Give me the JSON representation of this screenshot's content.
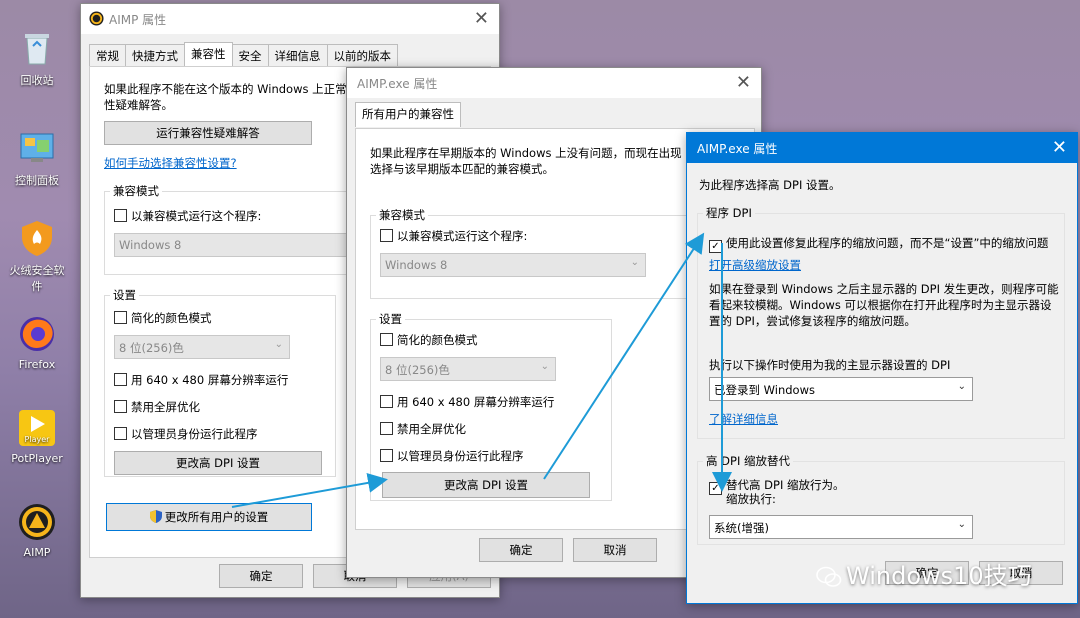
{
  "desktop": {
    "icons": [
      "回收站",
      "控制面板",
      "火绒安全软件",
      "Firefox",
      "PotPlayer",
      "AIMP"
    ],
    "potplayer_badge": "Player"
  },
  "win1": {
    "title": "AIMP 属性",
    "tabs": [
      "常规",
      "快捷方式",
      "兼容性",
      "安全",
      "详细信息",
      "以前的版本"
    ],
    "intro": "如果此程序不能在这个版本的 Windows 上正常",
    "intro2": "性疑难解答。",
    "troubleshoot_btn": "运行兼容性疑难解答",
    "manual_link": "如何手动选择兼容性设置?",
    "compat_group": "兼容模式",
    "compat_cb": "以兼容模式运行这个程序:",
    "compat_select": "Windows 8",
    "settings_group": "设置",
    "color_cb": "简化的颜色模式",
    "color_select": "8 位(256)色",
    "res_cb": "用 640 x 480 屏幕分辨率运行",
    "fullscreen_cb": "禁用全屏优化",
    "admin_cb": "以管理员身份运行此程序",
    "dpi_btn": "更改高 DPI 设置",
    "all_users_btn": "更改所有用户的设置",
    "ok": "确定",
    "cancel": "取消",
    "apply": "应用(A)"
  },
  "win2": {
    "title": "AIMP.exe 属性",
    "tab": "所有用户的兼容性",
    "intro": "如果此程序在早期版本的 Windows 上没有问题，而现在出现",
    "intro2": "选择与该早期版本匹配的兼容模式。",
    "compat_group": "兼容模式",
    "compat_cb": "以兼容模式运行这个程序:",
    "compat_select": "Windows 8",
    "settings_group": "设置",
    "color_cb": "简化的颜色模式",
    "color_select": "8 位(256)色",
    "res_cb": "用 640 x 480 屏幕分辨率运行",
    "fullscreen_cb": "禁用全屏优化",
    "admin_cb": "以管理员身份运行此程序",
    "dpi_btn": "更改高 DPI 设置",
    "ok": "确定",
    "cancel": "取消"
  },
  "win3": {
    "title": "AIMP.exe 属性",
    "heading": "为此程序选择高 DPI 设置。",
    "program_dpi_group": "程序 DPI",
    "fix_cb": "使用此设置修复此程序的缩放问题，而不是“设置”中的缩放问题",
    "advanced_link": "打开高级缩放设置",
    "desc1": "如果在登录到 Windows 之后主显示器的 DPI 发生更改，则程序可能",
    "desc2": "看起来较模糊。Windows 可以根据你在打开此程序时为主显示器设",
    "desc3": "置的 DPI，尝试修复该程序的缩放问题。",
    "when_label": "执行以下操作时使用为我的主显示器设置的 DPI",
    "when_select": "已登录到 Windows",
    "learn_link": "了解详细信息",
    "override_group": "高 DPI 缩放替代",
    "override_cb": "替代高 DPI 缩放行为。",
    "scaling_label": "缩放执行:",
    "scaling_select": "系统(增强)",
    "ok": "确定",
    "cancel": "取消"
  },
  "watermark": "Windows10技巧",
  "colors": {
    "arrow": "#1e9bd7",
    "title_active": "#0078d7",
    "link": "#0066cc"
  }
}
